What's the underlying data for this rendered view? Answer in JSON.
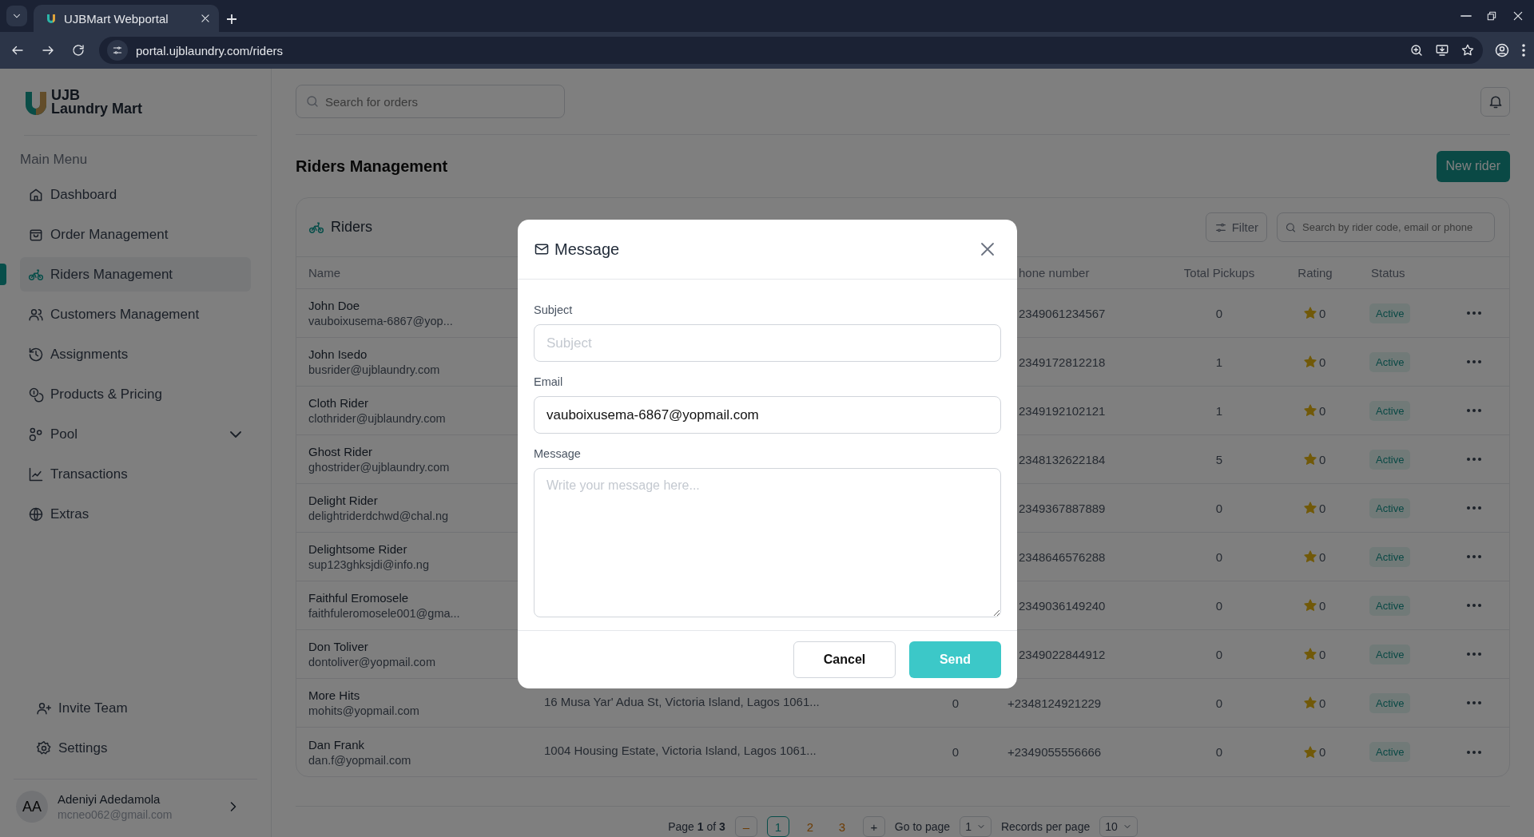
{
  "browser": {
    "tab_title": "UJBMart Webportal",
    "url": "portal.ujblaundry.com/riders"
  },
  "sidebar": {
    "logo_line1": "UJB",
    "logo_line2": "Laundry Mart",
    "section_title": "Main Menu",
    "items": [
      {
        "label": "Dashboard",
        "selected": false,
        "has_submenu": false
      },
      {
        "label": "Order Management",
        "selected": false,
        "has_submenu": false
      },
      {
        "label": "Riders Management",
        "selected": true,
        "has_submenu": false
      },
      {
        "label": "Customers Management",
        "selected": false,
        "has_submenu": false
      },
      {
        "label": "Assignments",
        "selected": false,
        "has_submenu": false
      },
      {
        "label": "Products & Pricing",
        "selected": false,
        "has_submenu": false
      },
      {
        "label": "Pool",
        "selected": false,
        "has_submenu": true
      },
      {
        "label": "Transactions",
        "selected": false,
        "has_submenu": false
      },
      {
        "label": "Extras",
        "selected": false,
        "has_submenu": false
      }
    ],
    "bottom_items": [
      {
        "label": "Invite Team"
      },
      {
        "label": "Settings"
      }
    ],
    "user": {
      "initials": "AA",
      "name": "Adeniyi Adedamola",
      "email": "mcneo062@gmail.com"
    }
  },
  "header": {
    "search": {
      "placeholder": "Search for orders"
    }
  },
  "page": {
    "title": "Riders Management",
    "new_button": "New rider"
  },
  "table_card": {
    "title": "Riders",
    "filter_button": "Filter",
    "search": {
      "placeholder": "Search by rider code, email or phone"
    },
    "columns": [
      "Name",
      "",
      "",
      "hone number",
      "Total Pickups",
      "Rating",
      "Status"
    ],
    "rows": [
      {
        "name": "John Doe",
        "email": "vauboixusema-6867@yop...",
        "phone": "2349061234567",
        "pickups": "0",
        "rating": "0",
        "status": "Active"
      },
      {
        "name": "John Isedo",
        "email": "busrider@ujblaundry.com",
        "phone": "2349172812218",
        "pickups": "1",
        "rating": "0",
        "status": "Active"
      },
      {
        "name": "Cloth Rider",
        "email": "clothrider@ujblaundry.com",
        "phone": "2349192102121",
        "pickups": "1",
        "rating": "0",
        "status": "Active"
      },
      {
        "name": "Ghost Rider",
        "email": "ghostrider@ujblaundry.com",
        "phone": "2348132622184",
        "pickups": "5",
        "rating": "0",
        "status": "Active"
      },
      {
        "name": "Delight Rider",
        "email": "delightriderdchwd@chal.ng",
        "phone": "2349367887889",
        "pickups": "0",
        "rating": "0",
        "status": "Active"
      },
      {
        "name": "Delightsome Rider",
        "email": "sup123ghksjdi@info.ng",
        "phone": "2348646576288",
        "pickups": "0",
        "rating": "0",
        "status": "Active"
      },
      {
        "name": "Faithful Eromosele",
        "email": "faithfuleromosele001@gma...",
        "phone": "2349036149240",
        "pickups": "0",
        "rating": "0",
        "status": "Active"
      },
      {
        "name": "Don Toliver",
        "email": "dontoliver@yopmail.com",
        "phone": "2349022844912",
        "pickups": "0",
        "rating": "0",
        "status": "Active"
      },
      {
        "name": "More Hits",
        "email": "mohits@yopmail.com",
        "address": "16 Musa Yar' Adua St, Victoria Island, Lagos 1061...",
        "count": "0",
        "phone": "+2348124921229",
        "pickups": "0",
        "rating": "0",
        "status": "Active"
      },
      {
        "name": "Dan Frank",
        "email": "dan.f@yopmail.com",
        "address": "1004 Housing Estate, Victoria Island, Lagos 1061...",
        "count": "0",
        "phone": "+2349055556666",
        "pickups": "0",
        "rating": "0",
        "status": "Active"
      }
    ]
  },
  "pagination": {
    "page_label_prefix": "Page ",
    "current": "1",
    "page_label_mid": " of ",
    "total": "3",
    "prev": "–",
    "next": "+",
    "pages": [
      {
        "label": "1",
        "selected": true
      },
      {
        "label": "2",
        "selected": false
      },
      {
        "label": "3",
        "selected": false
      }
    ],
    "goto_label": "Go to page",
    "goto_value": "1",
    "records_label": "Records per page",
    "records_value": "10"
  },
  "modal": {
    "title": "Message",
    "fields": [
      {
        "kind": "input",
        "label": "Subject",
        "placeholder": "Subject"
      },
      {
        "kind": "input",
        "label": "Email",
        "value": "vauboixusema-6867@yopmail.com"
      },
      {
        "kind": "textarea",
        "label": "Message",
        "placeholder": "Write your message here..."
      }
    ],
    "cancel": "Cancel",
    "send": "Send"
  }
}
